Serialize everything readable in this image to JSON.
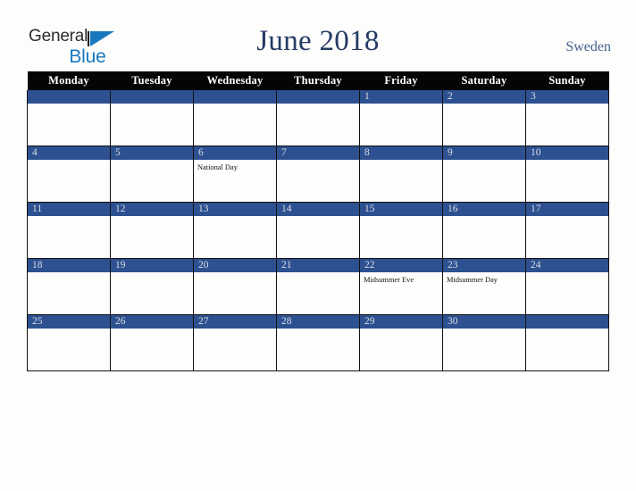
{
  "brand": {
    "name_top": "General",
    "name_bottom": "Blue",
    "accent_color": "#1878be"
  },
  "header": {
    "title": "June 2018",
    "region": "Sweden",
    "title_color": "#243a63",
    "region_color": "#46618e"
  },
  "calendar": {
    "month": "June",
    "year": "2018",
    "country": "Sweden",
    "header_background": "#050505",
    "date_bar_color": "#2d5190",
    "cell_background": "#fdfdfd",
    "weekday_headers": [
      "Monday",
      "Tuesday",
      "Wednesday",
      "Thursday",
      "Friday",
      "Saturday",
      "Sunday"
    ],
    "weeks": [
      [
        {
          "day": "",
          "event": ""
        },
        {
          "day": "",
          "event": ""
        },
        {
          "day": "",
          "event": ""
        },
        {
          "day": "",
          "event": ""
        },
        {
          "day": "1",
          "event": ""
        },
        {
          "day": "2",
          "event": ""
        },
        {
          "day": "3",
          "event": ""
        }
      ],
      [
        {
          "day": "4",
          "event": ""
        },
        {
          "day": "5",
          "event": ""
        },
        {
          "day": "6",
          "event": "National Day"
        },
        {
          "day": "7",
          "event": ""
        },
        {
          "day": "8",
          "event": ""
        },
        {
          "day": "9",
          "event": ""
        },
        {
          "day": "10",
          "event": ""
        }
      ],
      [
        {
          "day": "11",
          "event": ""
        },
        {
          "day": "12",
          "event": ""
        },
        {
          "day": "13",
          "event": ""
        },
        {
          "day": "14",
          "event": ""
        },
        {
          "day": "15",
          "event": ""
        },
        {
          "day": "16",
          "event": ""
        },
        {
          "day": "17",
          "event": ""
        }
      ],
      [
        {
          "day": "18",
          "event": ""
        },
        {
          "day": "19",
          "event": ""
        },
        {
          "day": "20",
          "event": ""
        },
        {
          "day": "21",
          "event": ""
        },
        {
          "day": "22",
          "event": "Midsummer Eve"
        },
        {
          "day": "23",
          "event": "Midsummer Day"
        },
        {
          "day": "24",
          "event": ""
        }
      ],
      [
        {
          "day": "25",
          "event": ""
        },
        {
          "day": "26",
          "event": ""
        },
        {
          "day": "27",
          "event": ""
        },
        {
          "day": "28",
          "event": ""
        },
        {
          "day": "29",
          "event": ""
        },
        {
          "day": "30",
          "event": ""
        },
        {
          "day": "",
          "event": ""
        }
      ]
    ]
  }
}
